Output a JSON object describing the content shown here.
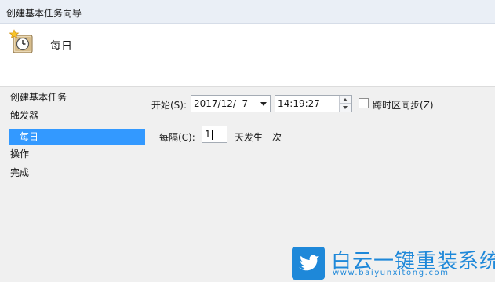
{
  "window": {
    "title": "创建基本任务向导"
  },
  "header": {
    "title": "每日",
    "icon": "clock-icon"
  },
  "nav": {
    "items": [
      {
        "label": "创建基本任务"
      },
      {
        "label": "触发器"
      },
      {
        "label": "每日",
        "selected": true
      },
      {
        "label": "操作"
      },
      {
        "label": "完成"
      }
    ]
  },
  "form": {
    "start_label": "开始(S):",
    "start_date": "2017/12/  7",
    "start_time": "14:19:27",
    "sync_label": "跨时区同步(Z)",
    "sync_checked": false,
    "recur_label": "每隔(C):",
    "recur_value": "1",
    "recur_suffix": "天发生一次"
  },
  "watermark": {
    "name": "白云一键重装系统",
    "url": "www.baiyunxitong.com",
    "color": "#1e88d9"
  },
  "colors": {
    "selection": "#3399ff",
    "titlebar": "#eaeff6",
    "panel": "#f0f0f0"
  }
}
